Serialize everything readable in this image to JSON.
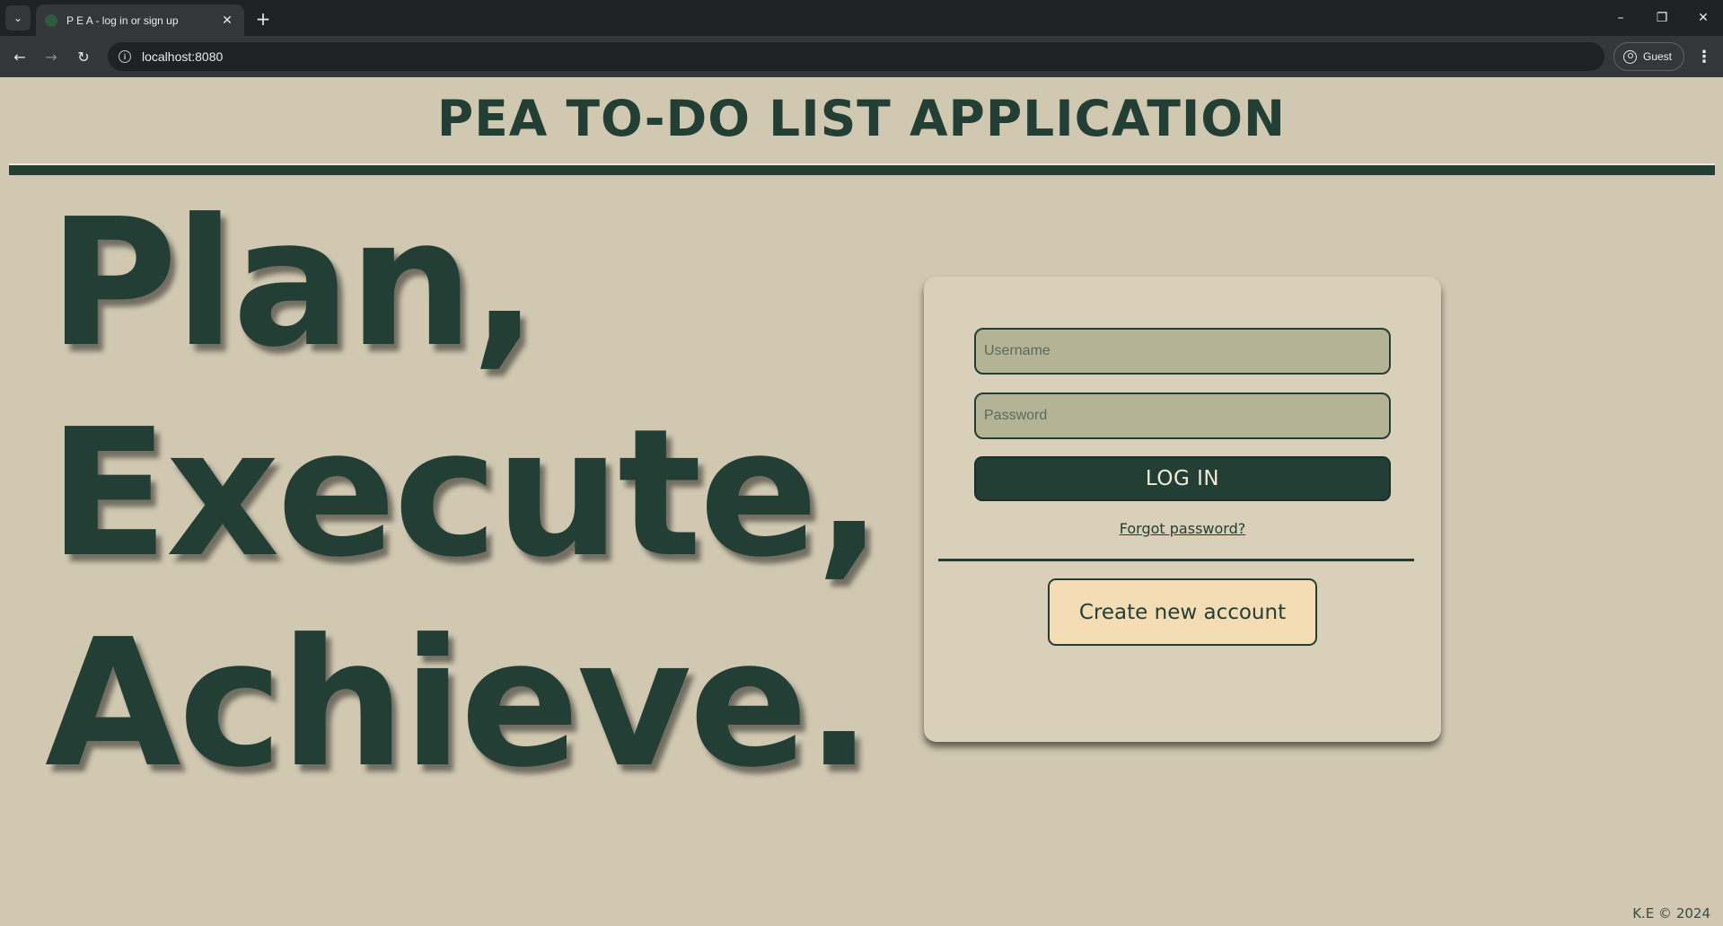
{
  "browser": {
    "tab_title": "P E A - log in or sign up",
    "tab_close": "✕",
    "new_tab": "+",
    "url": "localhost:8080",
    "profile_label": "Guest",
    "controls": {
      "minimize": "–",
      "restore": "❐",
      "close": "✕"
    },
    "nav": {
      "back": "←",
      "forward": "→",
      "reload": "↻",
      "menu": "⋮",
      "tab_menu": "⌄",
      "info": "i"
    }
  },
  "header": {
    "title": "PEA TO-DO LIST APPLICATION"
  },
  "slogan": {
    "line1": "Plan,",
    "line2": "Execute,",
    "line3": "Achieve."
  },
  "login": {
    "username_placeholder": "Username",
    "password_placeholder": "Password",
    "login_label": "LOG IN",
    "forgot_label": "Forgot password?",
    "create_label": "Create new account"
  },
  "footer": {
    "text": "K.E © 2024"
  },
  "colors": {
    "background": "#d0c8b1",
    "primary": "#233f35",
    "card": "#d8d0b9",
    "input": "#b4b395",
    "create_button": "#f4dcb5"
  }
}
